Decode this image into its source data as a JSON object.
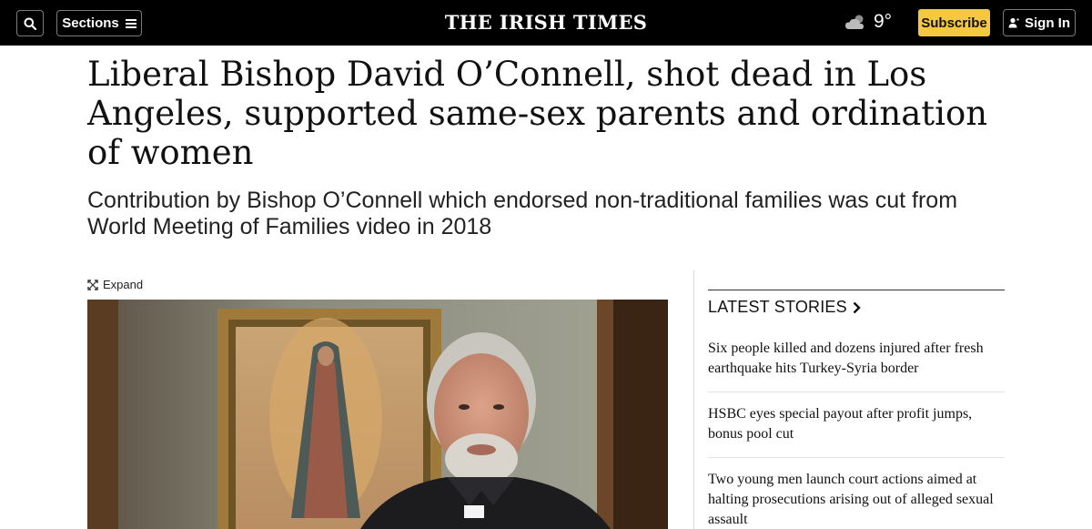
{
  "header": {
    "logo": "THE IRISH TIMES",
    "sections_label": "Sections",
    "temperature": "9°",
    "subscribe_label": "Subscribe",
    "signin_label": "Sign In",
    "icons": [
      "search-icon",
      "hamburger-icon",
      "cloud-icon",
      "user-icon"
    ],
    "subscribe_color": "#f5c842"
  },
  "article": {
    "headline": "Liberal Bishop David O’Connell, shot dead in Los Angeles, supported same-sex parents and ordination of women",
    "subheadline": "Contribution by Bishop O’Connell which endorsed non-traditional families was cut from World Meeting of Families video in 2018",
    "expand_label": "Expand"
  },
  "sidebar": {
    "title": "LATEST STORIES",
    "stories": [
      "Six people killed and dozens injured after fresh earthquake hits Turkey-Syria border",
      "HSBC eyes special payout after profit jumps, bonus pool cut",
      "Two young men launch court actions aimed at halting prosecutions arising out of alleged sexual assault"
    ]
  }
}
